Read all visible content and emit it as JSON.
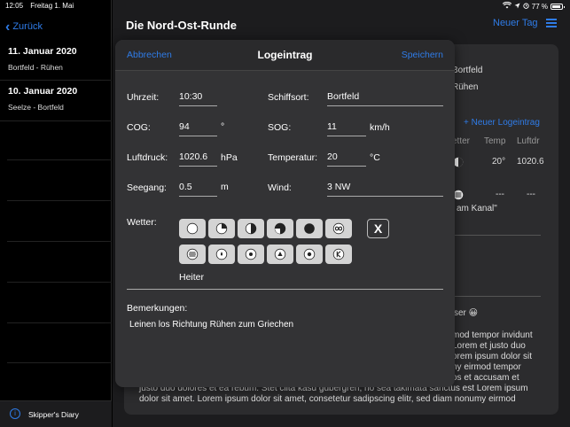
{
  "status_bar": {
    "time": "12:05",
    "date": "Freitag 1. Mai",
    "battery": "77 %",
    "battery_level": 0.77
  },
  "sidebar": {
    "back_label": "Zurück",
    "trips": [
      {
        "date": "11. Januar 2020",
        "route": "Bortfeld - Rühen"
      },
      {
        "date": "10. Januar 2020",
        "route": "Seelze - Bortfeld"
      }
    ],
    "footer_label": "Skipper's Diary"
  },
  "main": {
    "title": "Die Nord-Ost-Runde",
    "new_day_label": "Neuer Tag",
    "background": {
      "from": "Bortfeld",
      "to": "Rühen",
      "new_log_entry": "+ Neuer Logeintrag",
      "col_wetter": "etter",
      "col_temp": "Temp",
      "col_luftdr": "Luftdr",
      "row1_temp": "20°",
      "row1_pressure": "1020.6",
      "row2_temp": "---",
      "row2_pressure": "---",
      "quote_fragment": "am Kanal\"",
      "dash_fragment": "-",
      "wasser_fragment": "ser 😀",
      "lorem_right": [
        "mod tempor invidunt",
        "Lorem et justo duo",
        "orem ipsum dolor sit",
        "ny eirmod tempor",
        "os et accusam et"
      ],
      "lorem_full": [
        "justo duo dolores et ea rebum. Stet clita kasd gubergren, no sea takimata sanctus est Lorem ipsum",
        "dolor sit amet. Lorem ipsum dolor sit amet, consetetur sadipscing elitr, sed diam nonumy eirmod"
      ]
    }
  },
  "modal": {
    "cancel_label": "Abbrechen",
    "title": "Logeintrag",
    "save_label": "Speichern",
    "fields": {
      "uhrzeit": {
        "label": "Uhrzeit:",
        "value": "10:30"
      },
      "schiffsort": {
        "label": "Schiffsort:",
        "value": "Bortfeld"
      },
      "cog": {
        "label": "COG:",
        "value": "94",
        "unit": "°"
      },
      "sog": {
        "label": "SOG:",
        "value": "11",
        "unit": "km/h"
      },
      "luftdruck": {
        "label": "Luftdruck:",
        "value": "1020.6",
        "unit": "hPa"
      },
      "temperatur": {
        "label": "Temperatur:",
        "value": "20",
        "unit": "°C"
      },
      "seegang": {
        "label": "Seegang:",
        "value": "0.5",
        "unit": "m"
      },
      "wind": {
        "label": "Wind:",
        "value": "3 NW"
      }
    },
    "weather": {
      "label": "Wetter:",
      "clear_label": "X",
      "icons_row1": [
        "clear-sky-icon",
        "quarter-cloud-icon",
        "half-cloud-icon",
        "three-quarter-cloud-icon",
        "overcast-icon",
        "haze-icon"
      ],
      "icons_row2": [
        "fog-icon",
        "drizzle-icon",
        "rain-icon",
        "snow-icon",
        "rain-shower-icon",
        "thunderstorm-icon"
      ],
      "selected": "Heiter"
    },
    "remarks": {
      "label": "Bemerkungen:",
      "text": "Leinen los Richtung Rühen zum Griechen"
    }
  }
}
